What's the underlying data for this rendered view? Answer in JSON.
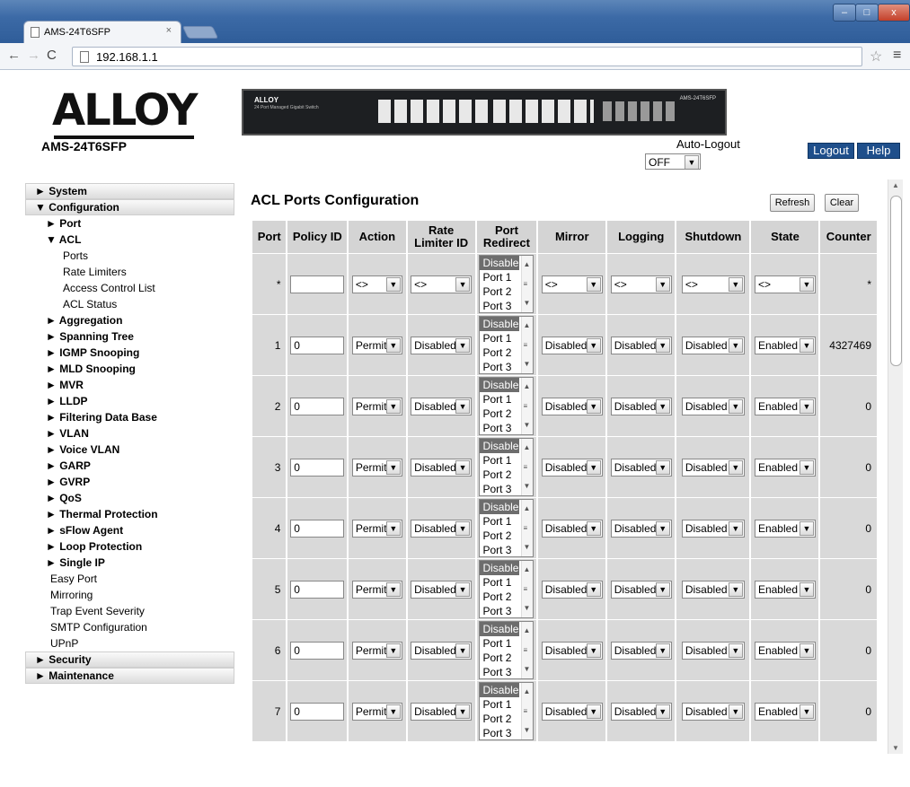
{
  "browser": {
    "tab_title": "AMS-24T6SFP",
    "tab_close": "×",
    "url": "192.168.1.1",
    "win_min": "–",
    "win_max": "□",
    "win_close": "x"
  },
  "header": {
    "logo": "ALLOY",
    "model": "AMS-24T6SFP",
    "switch_brand": "ALLOY",
    "switch_sub": "24 Port Managed Gigabit Switch",
    "switch_model": "AMS-24T6SFP",
    "auto_logout_label": "Auto-Logout",
    "auto_logout_value": "OFF",
    "logout": "Logout",
    "help": "Help"
  },
  "menu": [
    {
      "label": "► System",
      "level": 1
    },
    {
      "label": "▼ Configuration",
      "level": 1
    },
    {
      "label": "► Port",
      "level": 2
    },
    {
      "label": "▼ ACL",
      "level": 2
    },
    {
      "label": "Ports",
      "level": 3
    },
    {
      "label": "Rate Limiters",
      "level": 3
    },
    {
      "label": "Access Control List",
      "level": 3
    },
    {
      "label": "ACL Status",
      "level": 3
    },
    {
      "label": "► Aggregation",
      "level": 2
    },
    {
      "label": "► Spanning Tree",
      "level": 2
    },
    {
      "label": "► IGMP Snooping",
      "level": 2
    },
    {
      "label": "► MLD Snooping",
      "level": 2
    },
    {
      "label": "► MVR",
      "level": 2
    },
    {
      "label": "► LLDP",
      "level": 2
    },
    {
      "label": "► Filtering Data Base",
      "level": 2
    },
    {
      "label": "► VLAN",
      "level": 2
    },
    {
      "label": "► Voice VLAN",
      "level": 2
    },
    {
      "label": "► GARP",
      "level": 2
    },
    {
      "label": "► GVRP",
      "level": 2
    },
    {
      "label": "► QoS",
      "level": 2
    },
    {
      "label": "► Thermal Protection",
      "level": 2
    },
    {
      "label": "► sFlow Agent",
      "level": 2
    },
    {
      "label": "► Loop Protection",
      "level": 2
    },
    {
      "label": "► Single IP",
      "level": 2
    },
    {
      "label": "Easy Port",
      "level": 4
    },
    {
      "label": "Mirroring",
      "level": 4
    },
    {
      "label": "Trap Event Severity",
      "level": 4
    },
    {
      "label": "SMTP Configuration",
      "level": 4
    },
    {
      "label": "UPnP",
      "level": 4
    },
    {
      "label": "► Security",
      "level": 1
    },
    {
      "label": "► Maintenance",
      "level": 1
    }
  ],
  "content": {
    "title": "ACL Ports Configuration",
    "refresh": "Refresh",
    "clear": "Clear",
    "columns": [
      "Port",
      "Policy ID",
      "Action",
      "Rate Limiter ID",
      "Port Redirect",
      "Mirror",
      "Logging",
      "Shutdown",
      "State",
      "Counter"
    ],
    "redirect_options": [
      "Disabled",
      "Port 1",
      "Port 2",
      "Port 3"
    ],
    "rows": [
      {
        "port": "*",
        "policy": "",
        "action": "<>",
        "rate": "<>",
        "mirror": "<>",
        "logging": "<>",
        "shutdown": "<>",
        "state": "<>",
        "counter": "*"
      },
      {
        "port": "1",
        "policy": "0",
        "action": "Permit",
        "rate": "Disabled",
        "mirror": "Disabled",
        "logging": "Disabled",
        "shutdown": "Disabled",
        "state": "Enabled",
        "counter": "4327469"
      },
      {
        "port": "2",
        "policy": "0",
        "action": "Permit",
        "rate": "Disabled",
        "mirror": "Disabled",
        "logging": "Disabled",
        "shutdown": "Disabled",
        "state": "Enabled",
        "counter": "0"
      },
      {
        "port": "3",
        "policy": "0",
        "action": "Permit",
        "rate": "Disabled",
        "mirror": "Disabled",
        "logging": "Disabled",
        "shutdown": "Disabled",
        "state": "Enabled",
        "counter": "0"
      },
      {
        "port": "4",
        "policy": "0",
        "action": "Permit",
        "rate": "Disabled",
        "mirror": "Disabled",
        "logging": "Disabled",
        "shutdown": "Disabled",
        "state": "Enabled",
        "counter": "0"
      },
      {
        "port": "5",
        "policy": "0",
        "action": "Permit",
        "rate": "Disabled",
        "mirror": "Disabled",
        "logging": "Disabled",
        "shutdown": "Disabled",
        "state": "Enabled",
        "counter": "0"
      },
      {
        "port": "6",
        "policy": "0",
        "action": "Permit",
        "rate": "Disabled",
        "mirror": "Disabled",
        "logging": "Disabled",
        "shutdown": "Disabled",
        "state": "Enabled",
        "counter": "0"
      },
      {
        "port": "7",
        "policy": "0",
        "action": "Permit",
        "rate": "Disabled",
        "mirror": "Disabled",
        "logging": "Disabled",
        "shutdown": "Disabled",
        "state": "Enabled",
        "counter": "0"
      }
    ]
  },
  "colors": {
    "title_bar": "#3c6aa6",
    "header_btn": "#1f4f8b",
    "cell_bg": "#d9d9d9",
    "selected": "#6d6d6d"
  },
  "icons": [
    "page-icon",
    "back-arrow-icon",
    "forward-arrow-icon",
    "reload-icon",
    "star-icon",
    "menu-icon",
    "dropdown-arrow-icon"
  ]
}
